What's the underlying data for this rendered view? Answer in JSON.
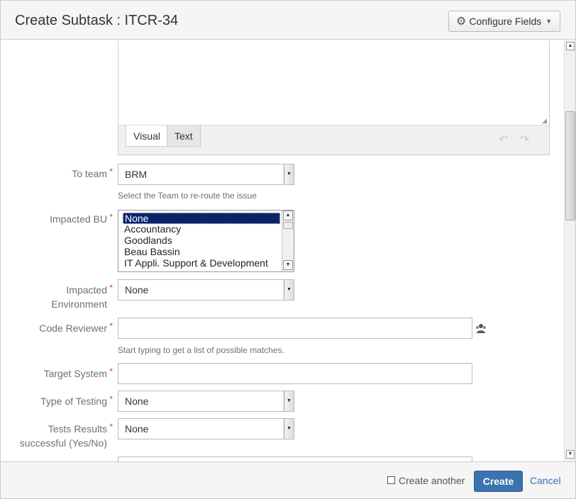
{
  "header": {
    "title": "Create Subtask : ITCR-34",
    "configure_fields_label": "Configure Fields"
  },
  "editor": {
    "tabs": [
      "Visual",
      "Text"
    ]
  },
  "fields": {
    "to_team": {
      "label": "To team",
      "value": "BRM",
      "description": "Select the Team to re-route the issue"
    },
    "impacted_bu": {
      "label": "Impacted BU",
      "options": [
        "None",
        "Accountancy",
        "Goodlands",
        "Beau Bassin",
        "IT Appli. Support & Development"
      ],
      "selected": "None"
    },
    "impacted_environment": {
      "label_line1": "Impacted",
      "label_line2": "Environment",
      "value": "None"
    },
    "code_reviewer": {
      "label": "Code Reviewer",
      "value": "",
      "description": "Start typing to get a list of possible matches."
    },
    "target_system": {
      "label": "Target System",
      "value": ""
    },
    "type_of_testing": {
      "label": "Type of Testing",
      "value": "None"
    },
    "tests_results": {
      "label_line1": "Tests Results",
      "label_line2": "successful (Yes/No)",
      "value": "None"
    }
  },
  "required_marker": "*",
  "footer": {
    "create_another_label": "Create another",
    "create_label": "Create",
    "cancel_label": "Cancel"
  },
  "colors": {
    "primary": "#3b73af",
    "required": "#d04437",
    "selection": "#0a246a"
  }
}
